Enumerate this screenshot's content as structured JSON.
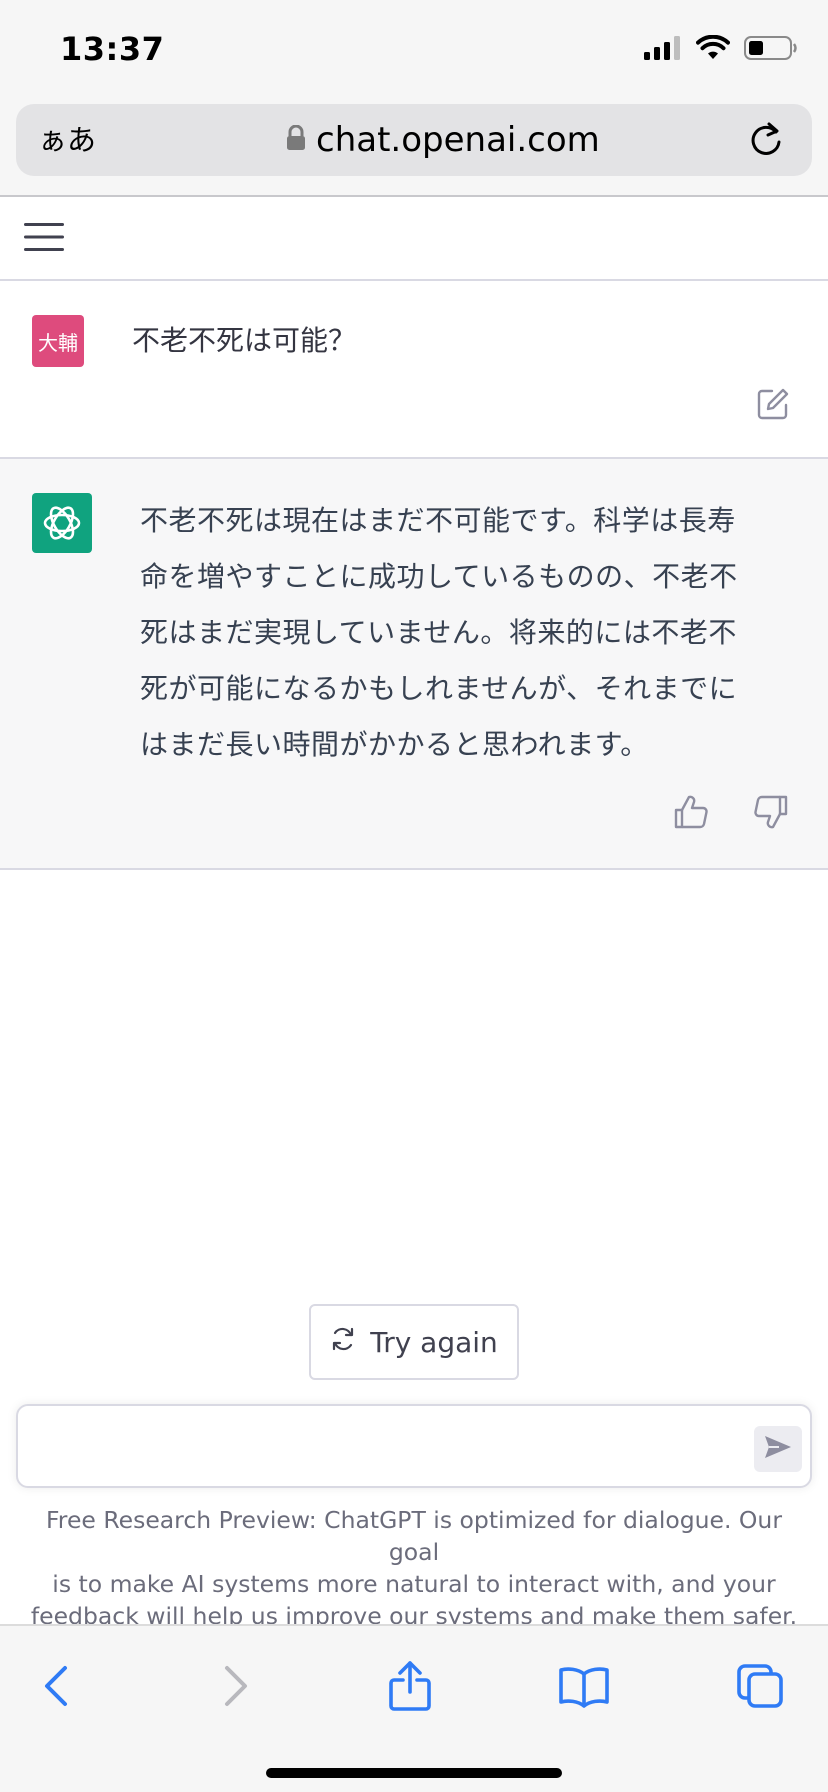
{
  "status_bar": {
    "time": "13:37"
  },
  "browser": {
    "aa_label": "ぁあ",
    "url": "chat.openai.com"
  },
  "conversation": {
    "user": {
      "avatar_text": "大輔",
      "avatar_color": "#de4b7d",
      "message": "不老不死は可能？"
    },
    "assistant": {
      "avatar_color": "#10a37f",
      "lines": [
        "不老不死は現在はまだ不可能です。科学は長寿",
        "命を増やすことに成功しているものの、不老不",
        "死はまだ実現していません。将来的には不老不",
        "死が可能になるかもしれませんが、それまでに",
        "はまだ長い時間がかかると思われます。"
      ]
    }
  },
  "actions": {
    "try_again": "Try again"
  },
  "input": {
    "value": "",
    "placeholder": ""
  },
  "disclaimer": {
    "lines": [
      "Free Research Preview: ChatGPT is optimized for dialogue. Our goal",
      "is to make AI systems more natural to interact with, and your",
      "feedback will help us improve our systems and make them safer."
    ]
  },
  "toolbar": {
    "icons": [
      "back-icon",
      "forward-icon",
      "share-icon",
      "bookmarks-icon",
      "tabs-icon"
    ]
  },
  "colors": {
    "accent_blue": "#2f7bf5",
    "user_avatar": "#de4b7d",
    "assistant_avatar": "#10a37f"
  }
}
